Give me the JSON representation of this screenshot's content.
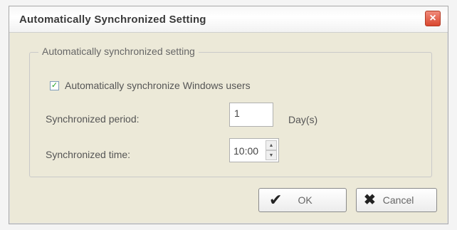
{
  "window": {
    "title": "Automatically Synchronized Setting",
    "close_icon": "close-icon"
  },
  "group": {
    "legend": "Automatically synchronized setting",
    "checkbox": {
      "label": "Automatically synchronize Windows users",
      "checked": true
    },
    "period": {
      "label": "Synchronized period:",
      "value": "1",
      "unit": "Day(s)"
    },
    "time": {
      "label": "Synchronized time:",
      "value": "10:00"
    }
  },
  "buttons": {
    "ok": {
      "label": "OK",
      "icon": "check-icon"
    },
    "cancel": {
      "label": "Cancel",
      "icon": "x-icon"
    }
  },
  "colors": {
    "dialog_bg": "#ece9d8",
    "close_button": "#d9472f",
    "check_mark": "#21a121"
  }
}
